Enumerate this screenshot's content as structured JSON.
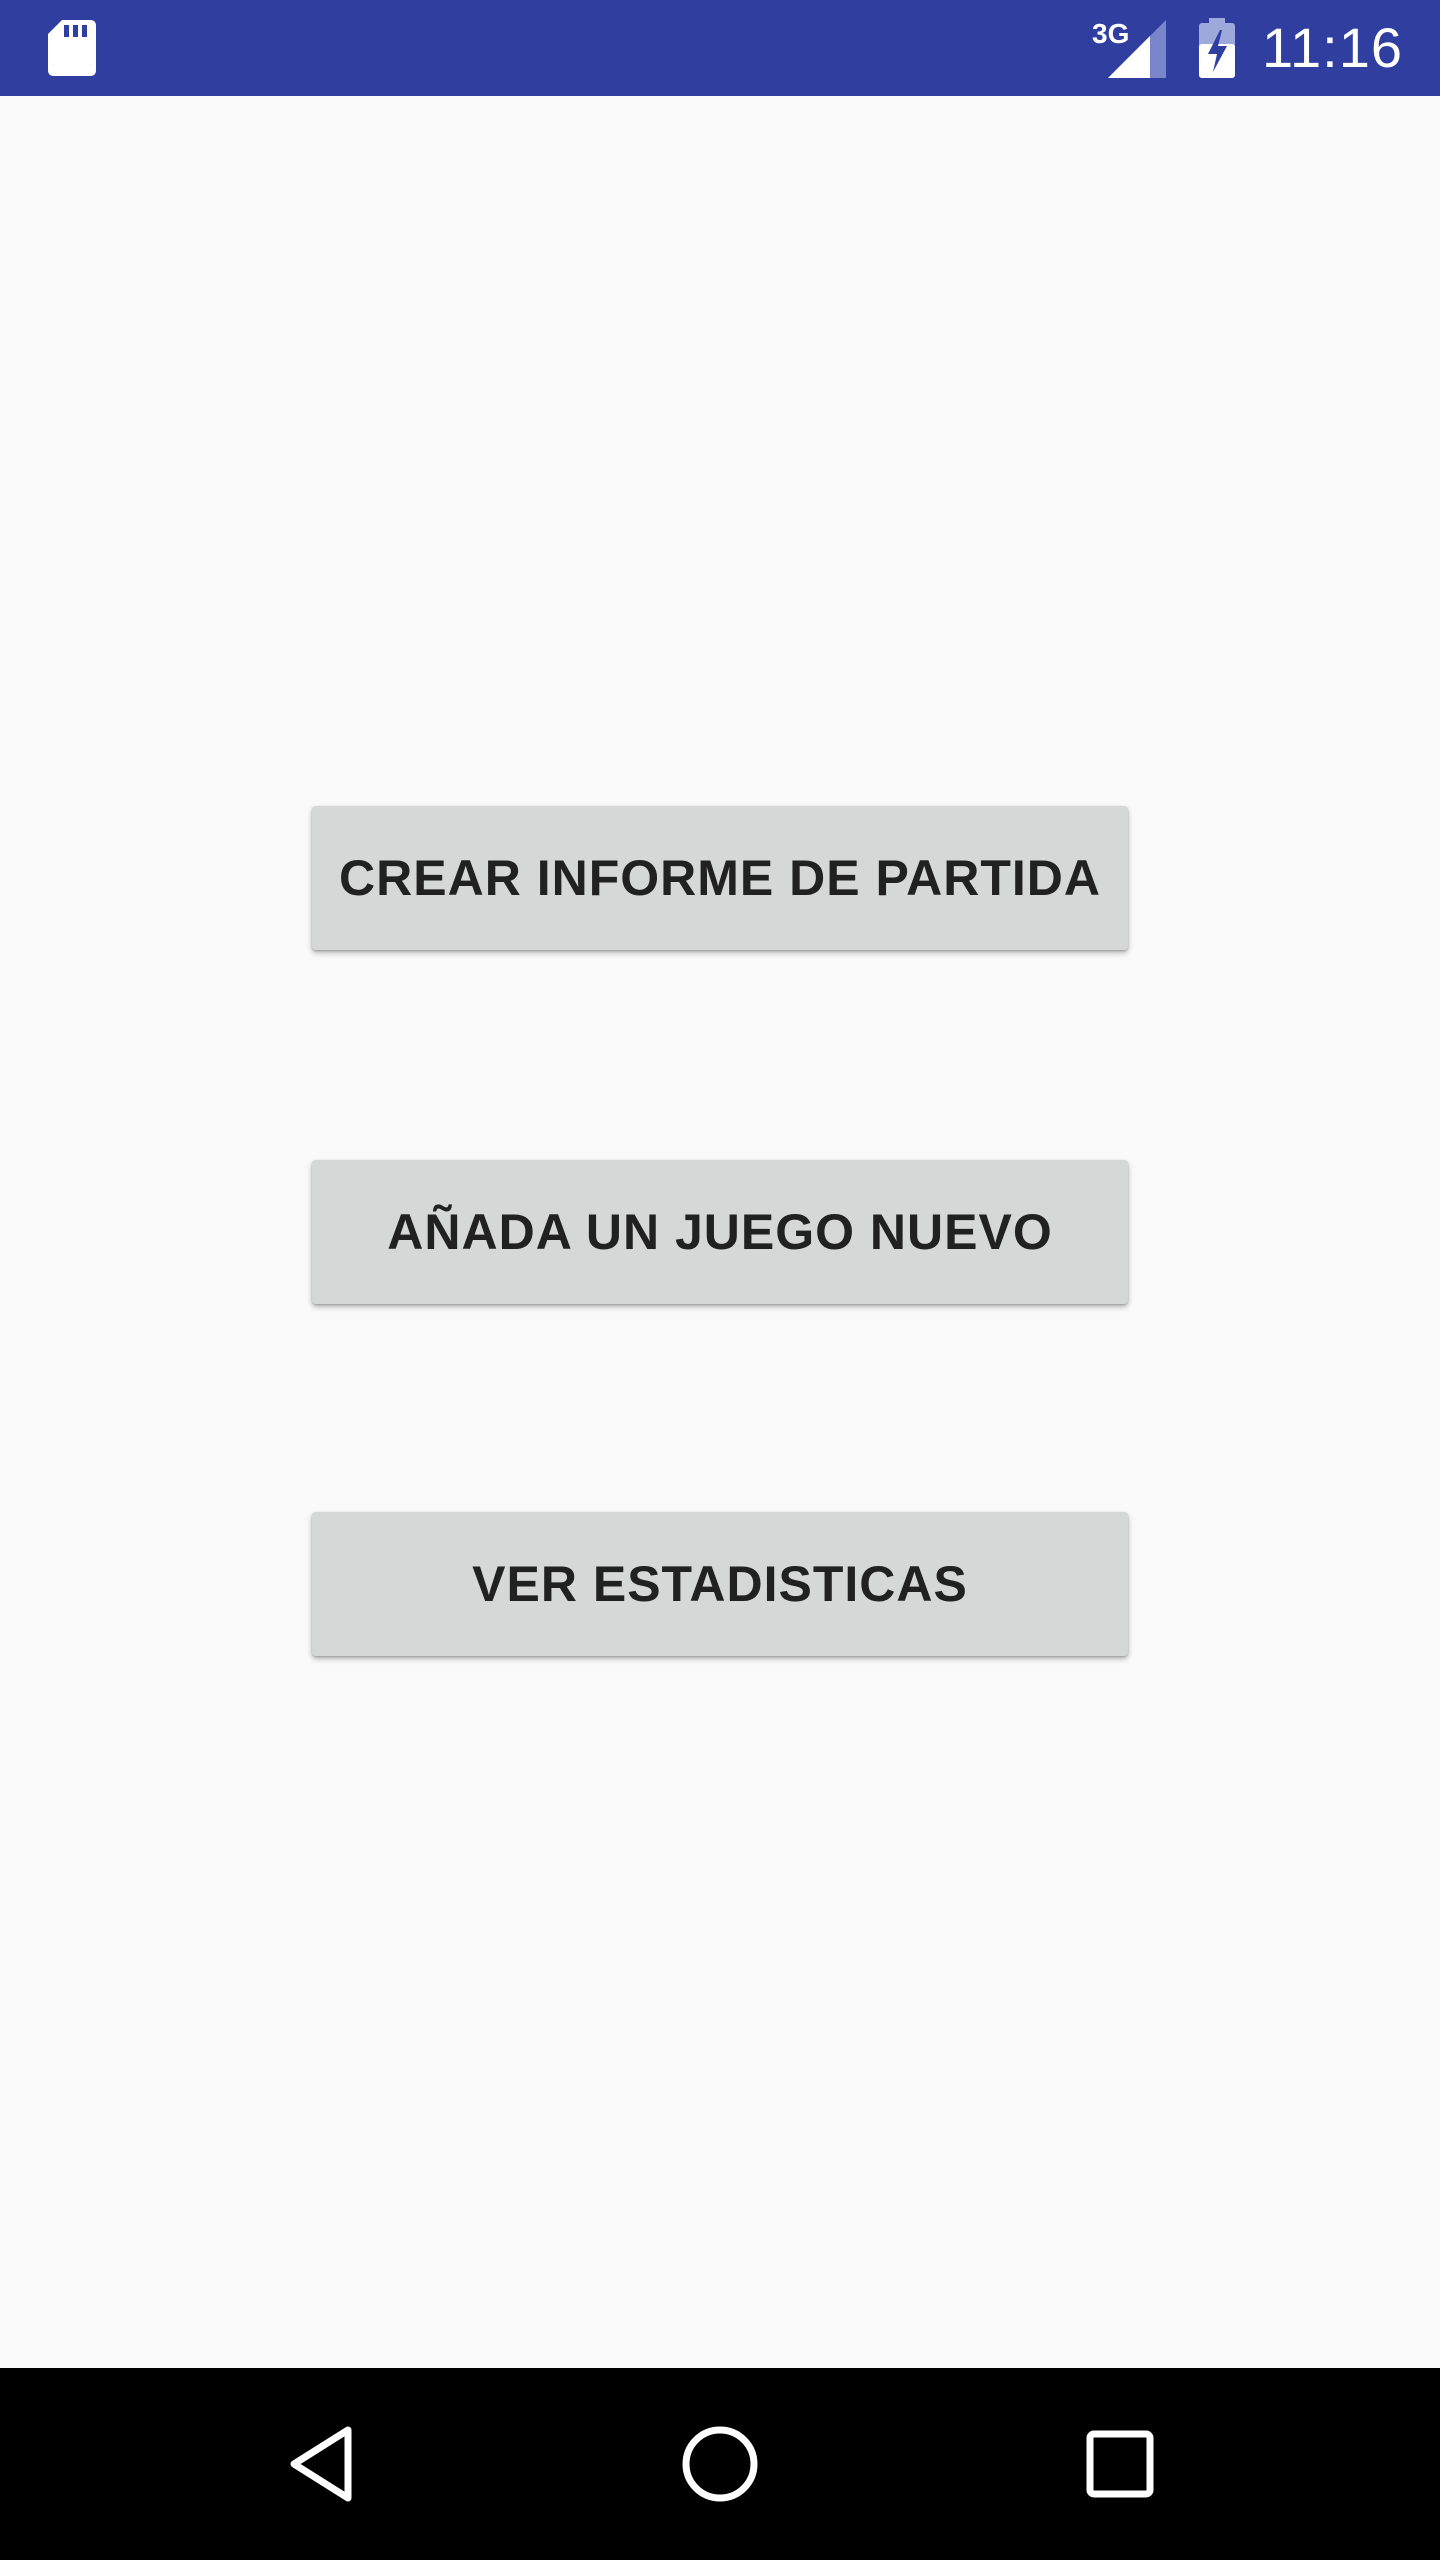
{
  "status_bar": {
    "network_type": "3G",
    "time": "11:16",
    "background_color": "#303f9f",
    "icons": [
      "sd-card-icon",
      "signal-icon",
      "battery-charging-icon"
    ]
  },
  "main": {
    "buttons": [
      {
        "label": "CREAR INFORME DE PARTIDA"
      },
      {
        "label": "AÑADA UN JUEGO NUEVO"
      },
      {
        "label": "VER ESTADISTICAS"
      }
    ]
  },
  "nav_bar": {
    "icons": [
      "back-icon",
      "home-icon",
      "recents-icon"
    ]
  }
}
